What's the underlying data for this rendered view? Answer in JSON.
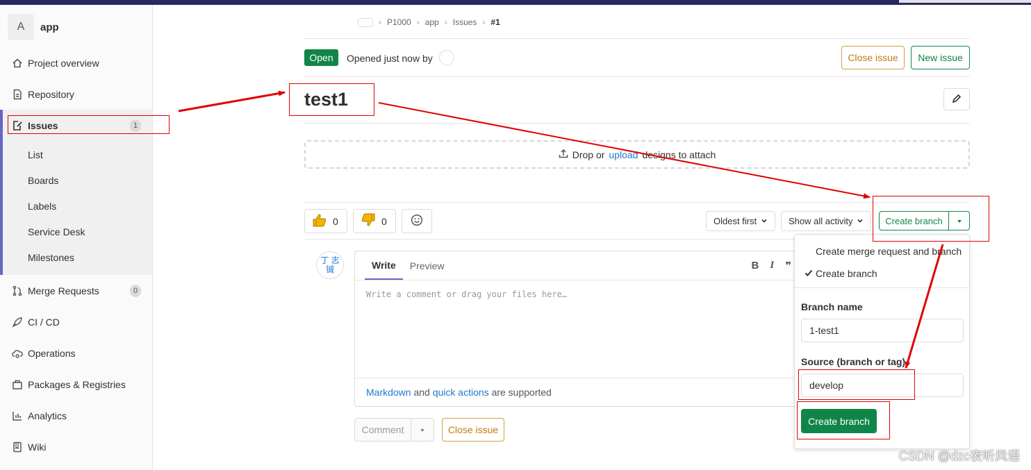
{
  "sidebar": {
    "project_avatar": "A",
    "project_name": "app",
    "items": [
      {
        "label": "Project overview",
        "icon": "home-icon"
      },
      {
        "label": "Repository",
        "icon": "doc-icon"
      },
      {
        "label": "Issues",
        "icon": "issues-icon",
        "badge": "1"
      },
      {
        "label": "Merge Requests",
        "icon": "merge-request-icon",
        "badge": "0"
      },
      {
        "label": "CI / CD",
        "icon": "rocket-icon"
      },
      {
        "label": "Operations",
        "icon": "cloud-gear-icon"
      },
      {
        "label": "Packages & Registries",
        "icon": "package-icon"
      },
      {
        "label": "Analytics",
        "icon": "chart-icon"
      },
      {
        "label": "Wiki",
        "icon": "book-icon"
      }
    ],
    "issues_sub": [
      "List",
      "Boards",
      "Labels",
      "Service Desk",
      "Milestones"
    ]
  },
  "breadcrumb": {
    "items": [
      "P1000",
      "app",
      "Issues"
    ],
    "current": "#1"
  },
  "issue": {
    "status": "Open",
    "opened_text": "Opened just now by",
    "title": "test1",
    "close_label": "Close issue",
    "new_label": "New issue"
  },
  "dropzone": {
    "prefix": "Drop or",
    "link": "upload",
    "suffix": "designs to attach"
  },
  "reactions": {
    "thumbs_up": "0",
    "thumbs_down": "0"
  },
  "sort": {
    "order": "Oldest first",
    "filter": "Show all activity"
  },
  "create_branch": {
    "label": "Create branch",
    "options": [
      "Create merge request and branch",
      "Create branch"
    ],
    "branch_name_label": "Branch name",
    "branch_name_value": "1-test1",
    "source_label": "Source (branch or tag)",
    "source_value": "develop",
    "submit_label": "Create branch"
  },
  "editor": {
    "tab_write": "Write",
    "tab_preview": "Preview",
    "placeholder": "Write a comment or drag your files here…",
    "footer_link1": "Markdown",
    "footer_and": "and",
    "footer_link2": "quick actions",
    "footer_suffix": "are supported",
    "avatar_alt": "丁 志铖"
  },
  "comment": {
    "comment_label": "Comment",
    "close_label": "Close issue"
  },
  "watermark": "CSDN @dzc夜听风语",
  "colors": {
    "accent": "#6666c4",
    "success": "#108548",
    "warning": "#c17d10",
    "link": "#1f78d1",
    "annotation": "#e00000"
  }
}
